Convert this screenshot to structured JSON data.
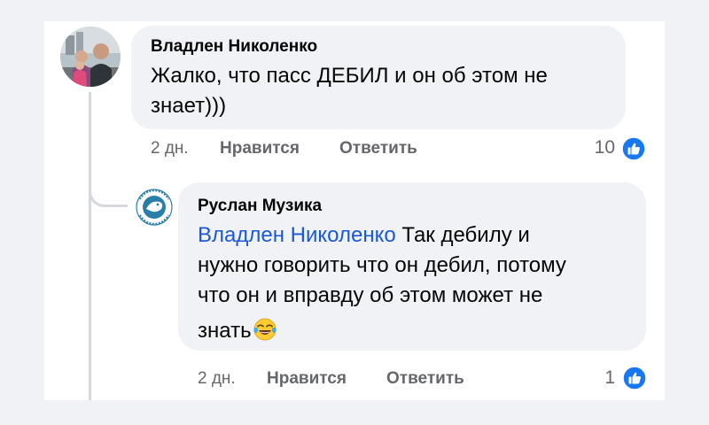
{
  "comments": [
    {
      "author": "Владлен Николенко",
      "text_line1": "Жалко, что пасс ДЕБИЛ и он об этом не",
      "text_line2": "знает)))",
      "time": "2 дн.",
      "like_label": "Нравится",
      "reply_label": "Ответить",
      "reaction_count": "10",
      "reaction_icon": "thumbs-up-icon"
    },
    {
      "author": "Руслан Музика",
      "mention": "Владлен Николенко",
      "text_line1": "Так дебилу и",
      "text_line2": "нужно говорить что он дебил, потому",
      "text_line3": "что он и вправду об этом может не",
      "text_line4": "знать",
      "emoji": "laughing-with-tears-emoji",
      "time": "2 дн.",
      "like_label": "Нравится",
      "reply_label": "Ответить",
      "reaction_count": "1",
      "reaction_icon": "thumbs-up-icon"
    }
  ],
  "colors": {
    "like_blue": "#1877f2",
    "mention_blue": "#1a59d6",
    "bubble_bg": "#f0f2f5",
    "meta_gray": "#65676b"
  }
}
